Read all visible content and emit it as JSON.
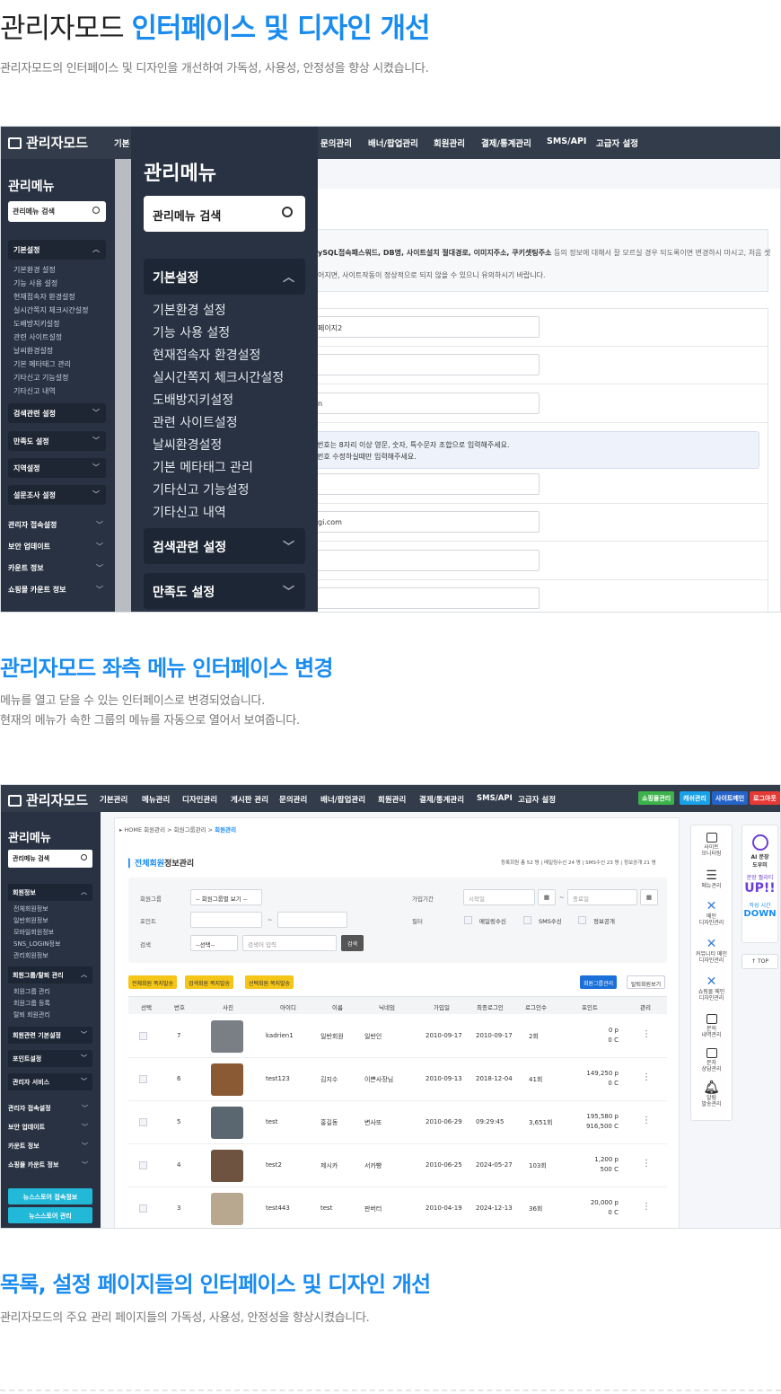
{
  "hero": {
    "title_plain": "관리자모드 ",
    "title_highlight": "인터페이스 및 디자인 개선",
    "subtitle": "관리자모드의 인터페이스 및 디자인을 개선하여 가독성, 사용성, 안정성을 향상 시켰습니다."
  },
  "shot1": {
    "logo": "관리자모드",
    "nav_first": "기본",
    "nav": [
      "문의관리",
      "배너/팝업관리",
      "회원관리",
      "결제/통계관리",
      "SMS/API",
      "고급자 설정"
    ],
    "sidebar": {
      "title": "관리메뉴",
      "search": "관리메뉴 검색",
      "group_open": "기본설정",
      "items": [
        "기본환경 설정",
        "기능 사용 설정",
        "현재접속자 환경설정",
        "실시간쪽지 체크시간설정",
        "도배방지키설정",
        "관련 사이트설정",
        "날씨환경설정",
        "기본 메타태그 관리",
        "기타신고 기능설정",
        "기타신고 내역"
      ],
      "groups": [
        "검색관련 설정",
        "만족도 설정",
        "지역설정",
        "설문조사 설정"
      ],
      "links": [
        "관리자 접속설정",
        "보안 업데이트",
        "카운트 정보",
        "쇼핑몰 카운트 정보"
      ]
    },
    "panel": {
      "title": "관리메뉴",
      "search": "관리메뉴 검색",
      "group_open": "기본설정",
      "items": [
        "기본환경 설정",
        "기능 사용 설정",
        "현재접속자 환경설정",
        "실시간쪽지 체크시간설정",
        "도배방지키설정",
        "관련 사이트설정",
        "날씨환경설정",
        "기본 메타태그 관리",
        "기타신고 기능설정",
        "기타신고 내역"
      ],
      "groups": [
        "검색관련 설정",
        "만족도 설정"
      ]
    },
    "content": {
      "warn1_bold": "ySQL접속패스워드, DB명, 사이트설치 절대경로, 이미지주소, 쿠키셋팅주소",
      "warn1_rest": " 등의 정보에 대해서 잘 모르실 경우 되도록이면 변경하시 마시고, 처음 셋",
      "warn2": "어지면, 사이트작동이 정상적으로 되지 않을 수 있으니 유의하시기 바랍니다.",
      "field1": "페이지2",
      "field3": "n",
      "note1": "번호는 8자리 이상 영문, 숫자, 특수문자 조합으로 입력해주세요.",
      "note2": "번호 수정하실때만 입력해주세요.",
      "field_email": "gi.com"
    }
  },
  "section2": {
    "title": "관리자모드 좌측 메뉴 인터페이스 변경",
    "line1": "메뉴를 열고 닫을 수 있는 인터페이스로 변경되었습니다.",
    "line2": "현재의 메뉴가 속한 그룹의 메뉴를 자동으로 열어서 보여줍니다."
  },
  "shot2": {
    "logo": "관리자모드",
    "nav": [
      "기본관리",
      "메뉴관리",
      "디자인관리",
      "게시판 관리",
      "문의관리",
      "배너/팝업관리",
      "회원관리",
      "결제/통계관리",
      "SMS/API",
      "고급자 설정"
    ],
    "buttons": [
      "쇼핑몰관리",
      "캐쉬관리",
      "사이트메인",
      "로그아웃"
    ],
    "button_colors": [
      "#3cb34a",
      "#18a0e8",
      "#2563c9",
      "#e53935"
    ],
    "sidebar": {
      "title": "관리메뉴",
      "search": "관리메뉴 검색",
      "group_open": "회원정보",
      "items1": [
        "전체회원정보",
        "일반회원정보",
        "모바일회원정보",
        "SNS_LOGIN정보",
        "관리회원정보"
      ],
      "group2": "회원그룹/탈퇴 관리",
      "items2": [
        "회원그룹 관리",
        "회원그룹 등록",
        "탈퇴 회원관리"
      ],
      "groups": [
        "회원관련 기본설정",
        "포인트설정",
        "관리자 서비스"
      ],
      "links": [
        "관리자 접속설정",
        "보안 업데이트",
        "카운트 정보",
        "쇼핑몰 카운트 정보"
      ],
      "cyan": [
        "뉴스스토어 접속정보",
        "뉴스스토어 관리"
      ]
    },
    "breadcrumb": {
      "home": "HOME 회원관리",
      "sep": ">",
      "mid": "회원그룹관리",
      "current": "회원관리"
    },
    "title_blue": "전체회원",
    "title_rest": "정보관리",
    "stats": "등록회원 총 52 명 | 메일링수신 24 명 | SMS수신 23 명 | 정보공개 21 명",
    "filters": {
      "group_label": "회원그룹",
      "group_select": "-- 회원그룹별 보기 --",
      "point_label": "포인트",
      "tilde": "~",
      "search_label": "검색",
      "search_select": "--선택--",
      "search_placeholder": "검색어 입력",
      "search_button": "검색",
      "join_label": "가입기간",
      "start": "시작일",
      "end": "종료일",
      "filter_label": "필터",
      "checks": [
        "메일링수신",
        "SMS수신",
        "정보공개"
      ]
    },
    "yellow_buttons": [
      "전체회원 쪽지발송",
      "검색회원 쪽지발송",
      "선택회원 쪽지발송"
    ],
    "group_btn": "회원그룹관리",
    "withdraw_btn": "탈퇴회원보기",
    "columns": [
      "선택",
      "번호",
      "사진",
      "아이디",
      "이름",
      "닉네임",
      "가입일",
      "최종로그인",
      "로그인수",
      "포인트",
      "관리"
    ],
    "rows": [
      {
        "no": "7",
        "id": "kadrien1",
        "name": "일반회원",
        "nick": "일반인",
        "join": "2010-09-17",
        "last": "2010-09-17",
        "count": "2회",
        "p1": "0 p",
        "p2": "0 C",
        "thumb": "#7a7f86"
      },
      {
        "no": "6",
        "id": "test123",
        "name": "김지수",
        "nick": "이쁜사장님",
        "join": "2010-09-13",
        "last": "2018-12-04",
        "count": "41회",
        "p1": "149,250 p",
        "p2": "0 C",
        "thumb": "#8a5a34"
      },
      {
        "no": "5",
        "id": "test",
        "name": "홍길동",
        "nick": "변사또",
        "join": "2010-06-29",
        "last": "09:29:45",
        "count": "3,651회",
        "p1": "195,580 p",
        "p2": "916,500 C",
        "thumb": "#5a6670"
      },
      {
        "no": "4",
        "id": "test2",
        "name": "제시카",
        "nick": "서카빵",
        "join": "2010-06-25",
        "last": "2024-05-27",
        "count": "103회",
        "p1": "1,200 p",
        "p2": "500 C",
        "thumb": "#6e5440"
      },
      {
        "no": "3",
        "id": "test443",
        "name": "test",
        "nick": "판버터",
        "join": "2010-04-19",
        "last": "2024-12-13",
        "count": "36회",
        "p1": "20,000 p",
        "p2": "0 C",
        "thumb": "#b8a890"
      }
    ],
    "tools": [
      "사이트\n모니터링",
      "메뉴관리",
      "메인\n디자인관리",
      "커뮤니티 메인\n디자인관리",
      "쇼핑몰 메인\n디자인관리",
      "문의\n내역관리",
      "문자\n상담관리",
      "알림\n발송관리"
    ],
    "ai": {
      "label1": "AI 문장",
      "label2": "도우미",
      "label3": "문장 퀄리티",
      "up": "UP!!",
      "label4": "작성 시간",
      "down": "DOWN"
    },
    "top": "↑ TOP"
  },
  "section3": {
    "title": "목록, 설정 페이지들의 인터페이스 및 디자인 개선",
    "line1": "관리자모드의 주요 관리 페이지들의 가독성, 사용성, 안정성을 향상시켰습니다."
  }
}
